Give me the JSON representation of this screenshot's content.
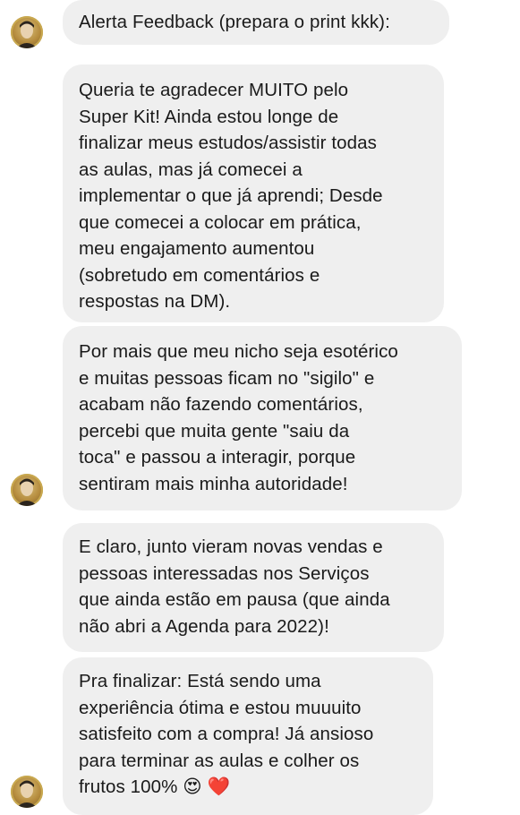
{
  "messages": [
    {
      "text": "Alerta Feedback (prepara o print kkk):"
    },
    {
      "text": "Queria te agradecer MUITO pelo\nSuper Kit! Ainda estou longe de\nfinalizar meus estudos/assistir todas\nas aulas, mas já comecei a\nimplementar o que já aprendi; Desde\nque comecei a colocar em prática,\nmeu engajamento aumentou\n(sobretudo em comentários e\nrespostas na DM)."
    },
    {
      "text": "Por mais que meu nicho seja esotérico\ne muitas pessoas ficam no \"sigilo\" e\nacabam não fazendo comentários,\npercebi que muita gente \"saiu da\ntoca\" e passou a interagir, porque\nsentiram mais minha autoridade!"
    },
    {
      "text": "E claro, junto vieram novas vendas e\npessoas interessadas nos Serviços\nque ainda estão em pausa (que ainda\nnão abri a Agenda para 2022)!"
    },
    {
      "text": "Pra finalizar: Está sendo uma\nexperiência ótima e estou muuuito\nsatisfeito com a compra! Já ansioso\npara terminar as aulas e colher os\nfrutos 100% ",
      "emojis": [
        "😍",
        "❤️"
      ]
    }
  ],
  "colors": {
    "bubble": "#efefef",
    "text": "#1a1a1a",
    "background": "#ffffff"
  }
}
